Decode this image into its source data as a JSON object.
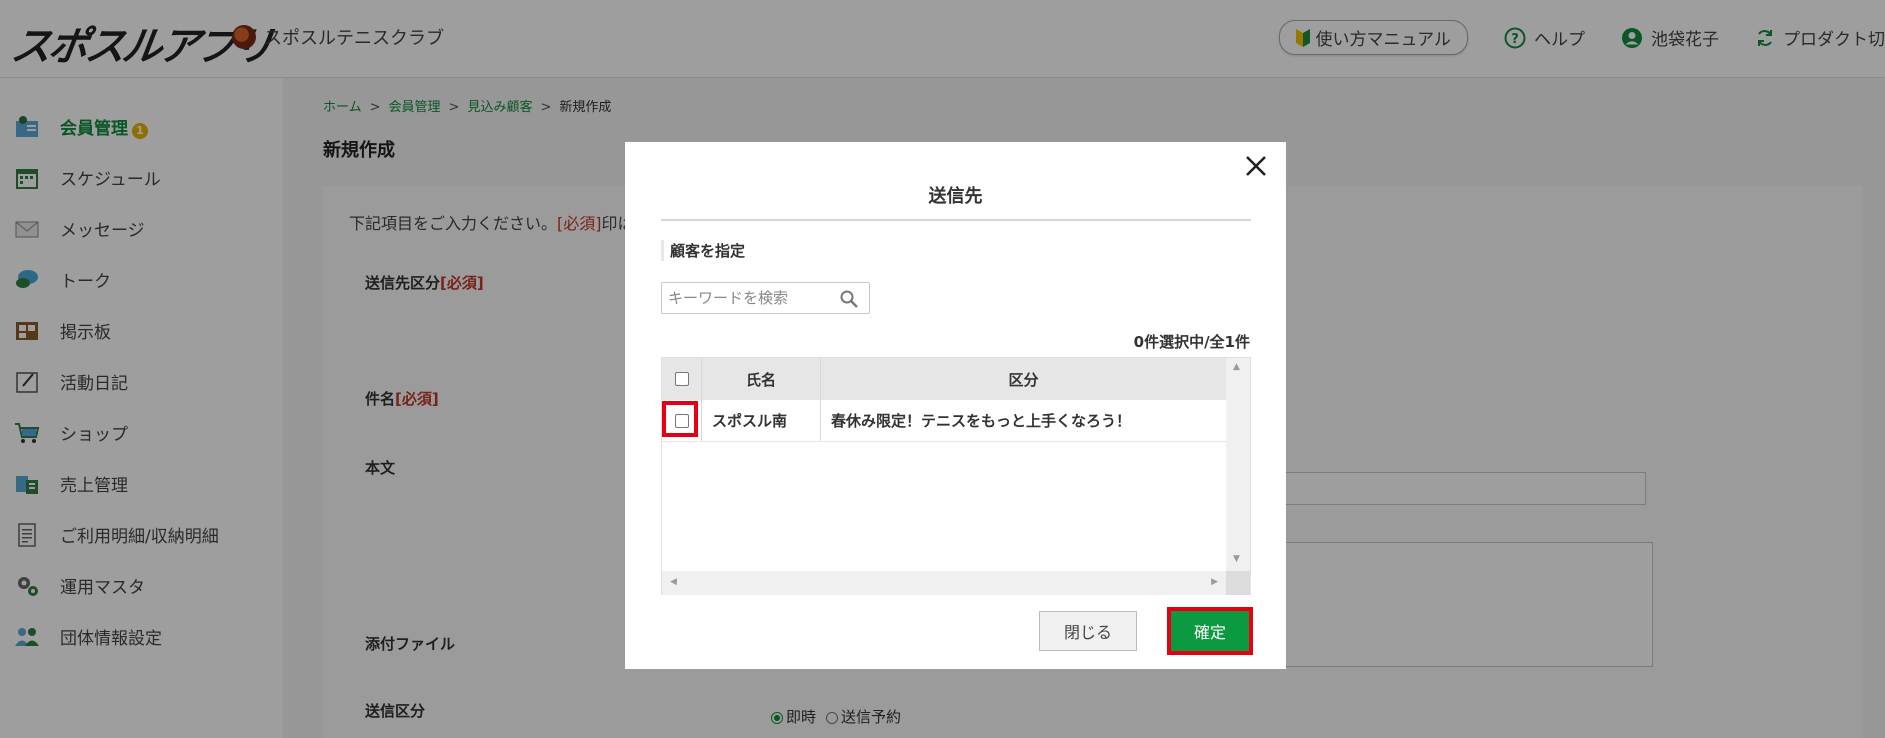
{
  "header": {
    "logo": "スポスルアプリ",
    "club_name": "スポスルテニスクラブ",
    "manual": "使い方マニュアル",
    "help": "ヘルプ",
    "user": "池袋花子",
    "product": "プロダクト切"
  },
  "sidebar": {
    "items": [
      {
        "label": "会員管理",
        "icon": "members-icon",
        "badge": "1",
        "active": true
      },
      {
        "label": "スケジュール",
        "icon": "calendar-icon"
      },
      {
        "label": "メッセージ",
        "icon": "mail-icon"
      },
      {
        "label": "トーク",
        "icon": "chat-icon"
      },
      {
        "label": "掲示板",
        "icon": "board-icon"
      },
      {
        "label": "活動日記",
        "icon": "diary-icon"
      },
      {
        "label": "ショップ",
        "icon": "cart-icon"
      },
      {
        "label": "売上管理",
        "icon": "sales-icon"
      },
      {
        "label": "ご利用明細/収納明細",
        "icon": "receipt-icon"
      },
      {
        "label": "運用マスタ",
        "icon": "gears-icon"
      },
      {
        "label": "団体情報設定",
        "icon": "group-icon"
      }
    ],
    "active_color": "#118c3e"
  },
  "breadcrumb": {
    "home": "ホーム",
    "members": "会員管理",
    "prospects": "見込み顧客",
    "current": "新規作成",
    "separator": ">"
  },
  "page": {
    "title": "新規作成",
    "note_prefix": "下記項目をご入力ください。",
    "note_req": "[必須]",
    "note_suffix": "印は",
    "labels": {
      "send_target": "送信先区分",
      "subject": "件名",
      "body": "本文",
      "attachment": "添付ファイル",
      "send_type": "送信区分"
    },
    "required_mark": "[必須]",
    "send_type_options": [
      "即時",
      "送信予約"
    ]
  },
  "modal": {
    "title": "送信先",
    "section": "顧客を指定",
    "search_placeholder": "キーワードを検索",
    "count_text": "0件選択中/全1件",
    "columns": [
      "氏名",
      "区分"
    ],
    "rows": [
      {
        "name": "スポスル南",
        "category": "春休み限定！テニスをもっと上手くなろう！",
        "checked": false
      }
    ],
    "close_label": "閉じる",
    "confirm_label": "確定",
    "confirm_color": "#0b9a3f",
    "highlight_color": "#e60012"
  }
}
